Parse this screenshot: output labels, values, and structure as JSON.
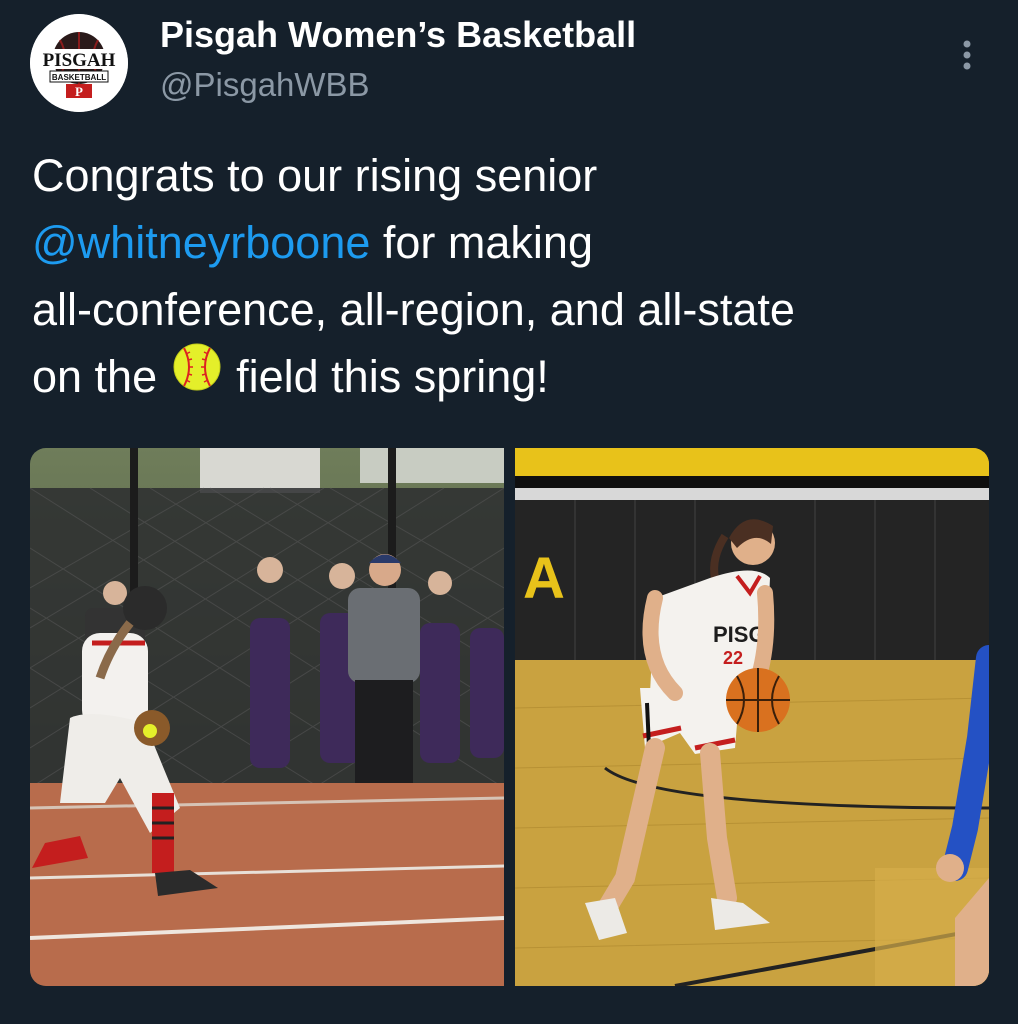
{
  "author": {
    "display_name": "Pisgah Women’s Basketball",
    "handle": "@PisgahWBB",
    "avatar_logo": {
      "top_text": "PISGAH",
      "bottom_text": "BASKETBALL",
      "letter": "P"
    }
  },
  "menu": {
    "icon": "more-vertical-icon"
  },
  "tweet": {
    "line1": "Congrats to our rising senior",
    "mention": "@whitneyrboone",
    "line2_rest": " for making",
    "line3": "all-conference, all-region, and all-state",
    "line4_before": "on the ",
    "emoji": "softball-emoji",
    "line4_after": " field this spring!"
  },
  "media": {
    "left": {
      "subject": "softball-player-photo",
      "jersey_text": ""
    },
    "right": {
      "subject": "basketball-player-photo",
      "jersey_text": "PISG",
      "jersey_number": "22",
      "wall_letter": "A"
    }
  },
  "colors": {
    "background": "#15202b",
    "text": "#ffffff",
    "secondary": "#8b98a5",
    "link": "#1d9bf0"
  }
}
